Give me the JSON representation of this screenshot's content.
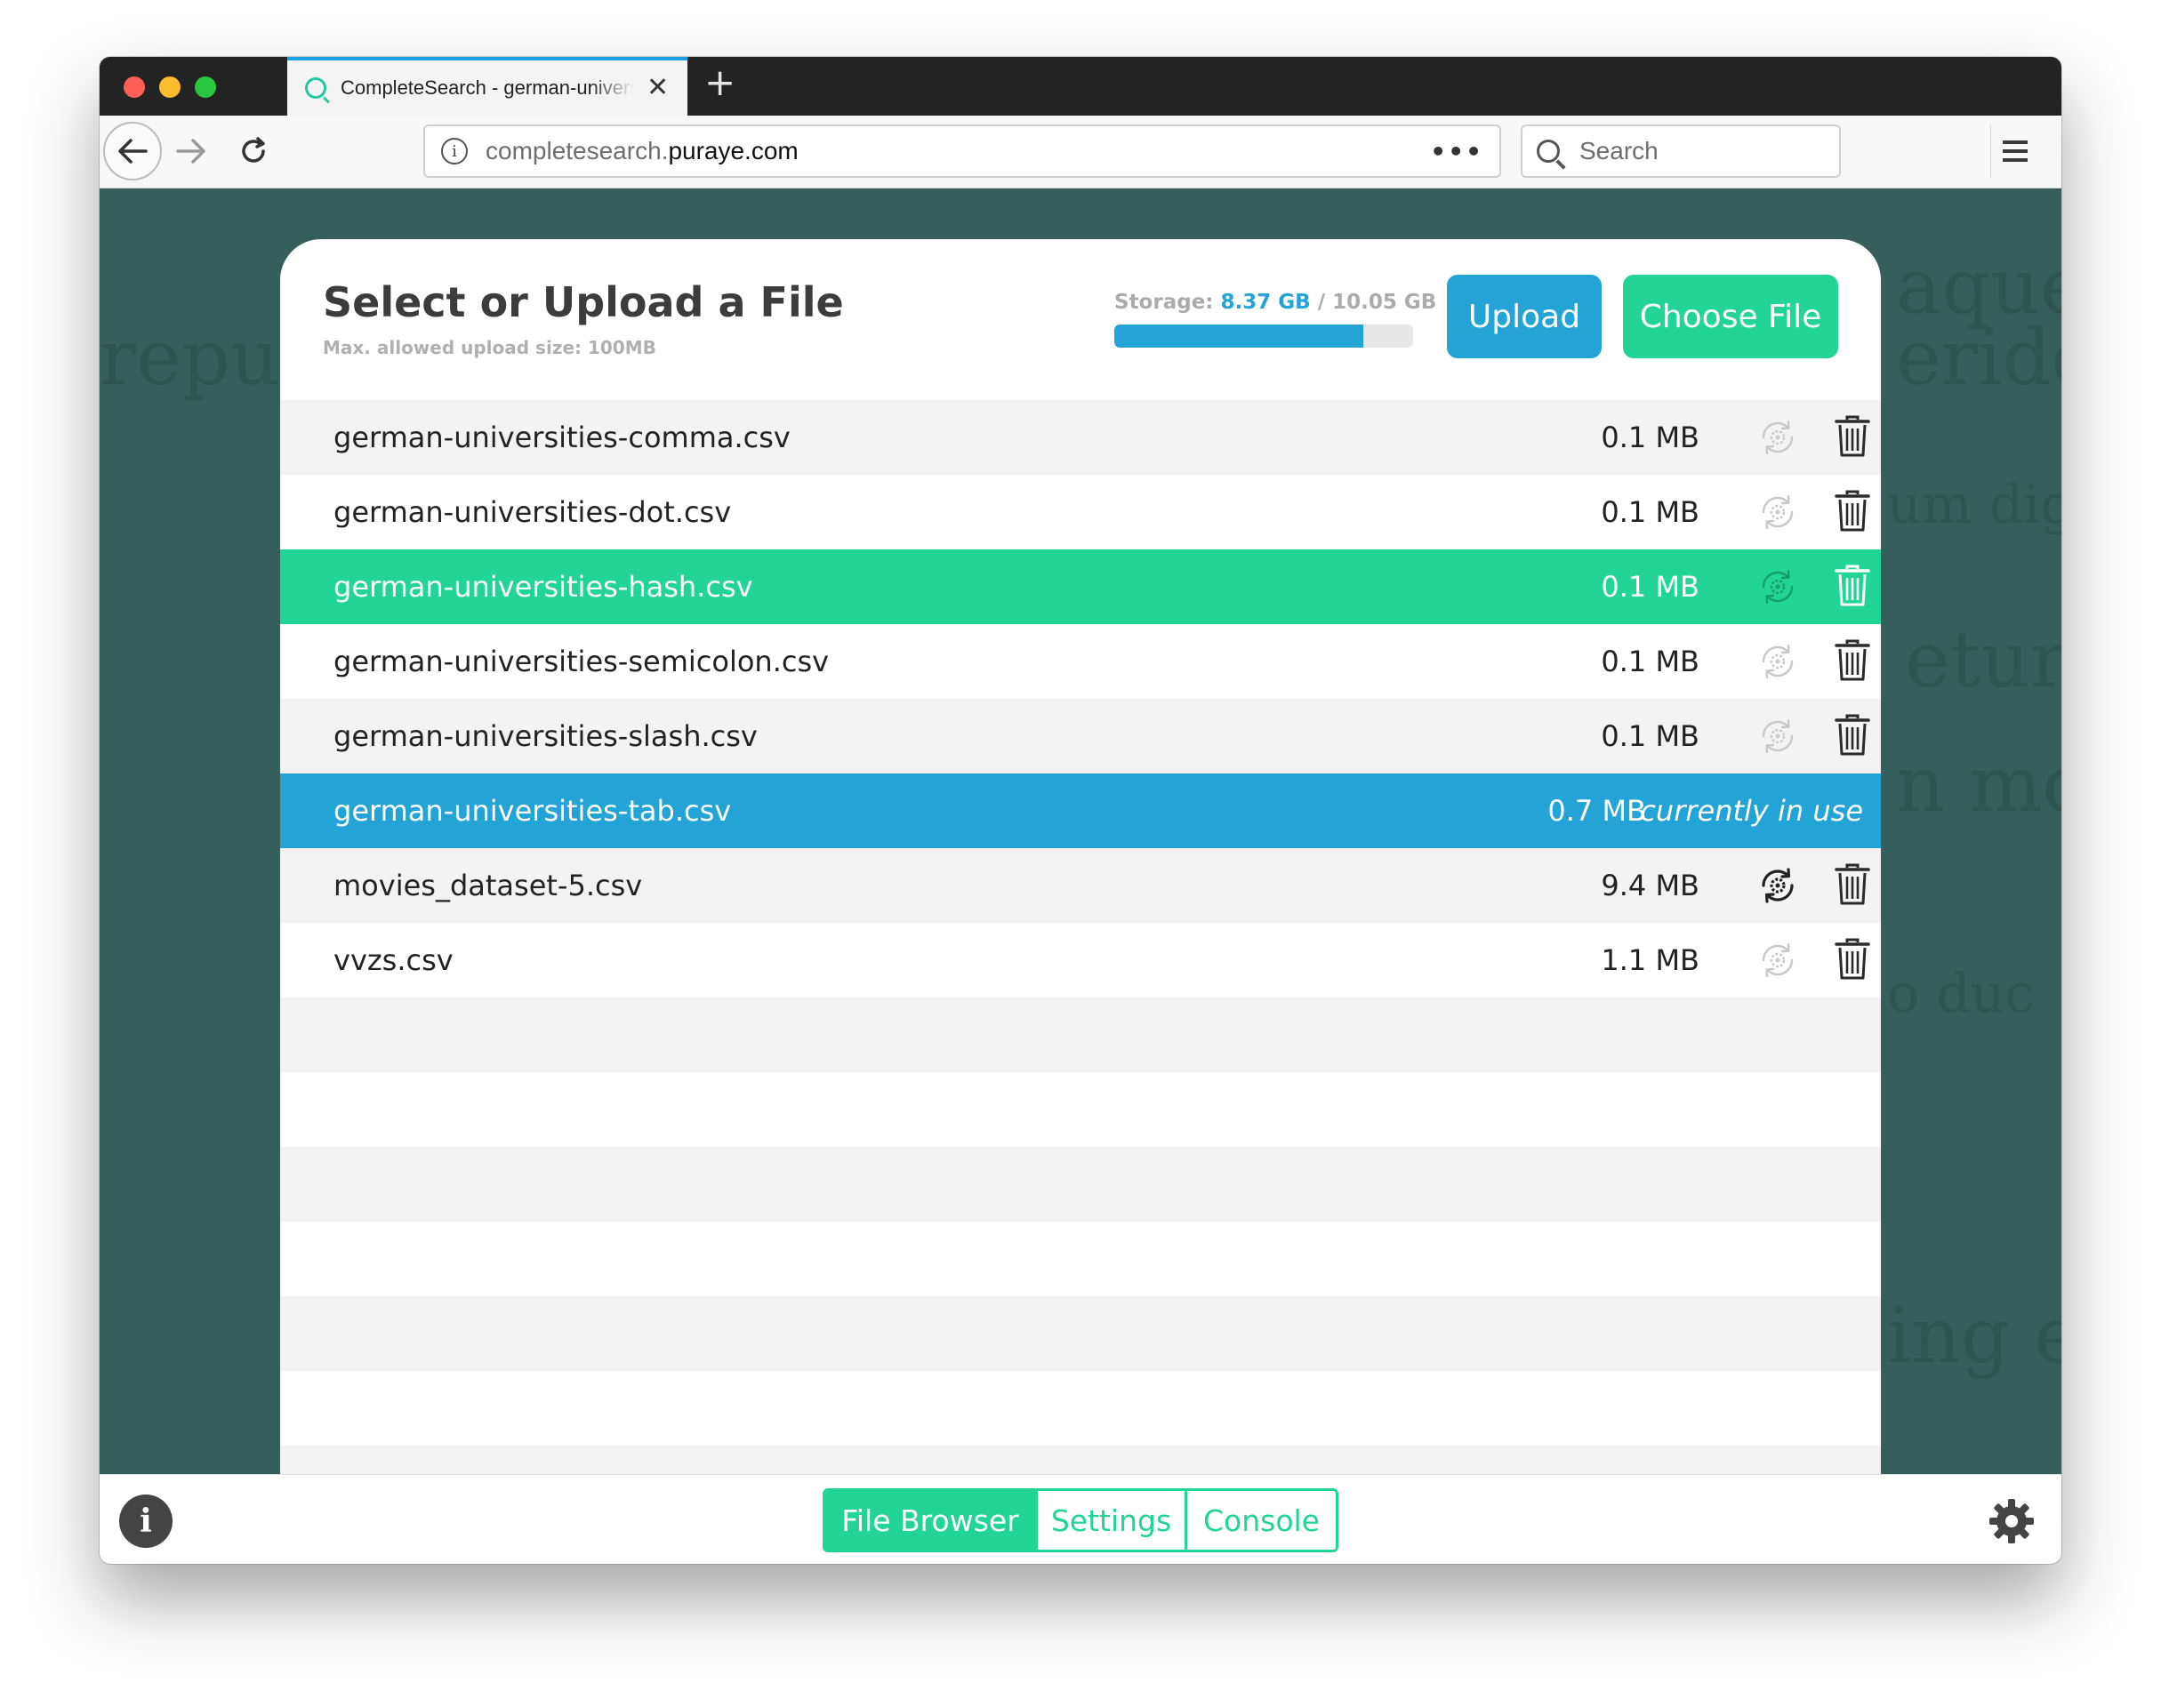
{
  "browser": {
    "tab_title": "CompleteSearch - german-universities-tab.csv",
    "tab_close": "✕",
    "new_tab": "+",
    "url_prefix": "completesearch.",
    "url_domain": "puraye.com",
    "url_more": "•••",
    "search_placeholder": "Search",
    "icons": {
      "back": "arrow-left-icon",
      "forward": "arrow-right-icon",
      "reload": "reload-icon",
      "info": "info-icon",
      "menu": "hamburger-menu-icon",
      "search": "search-icon"
    }
  },
  "dialog": {
    "title": "Select or Upload a File",
    "subtitle": "Max. allowed upload size: 100MB",
    "storage_label": "Storage:",
    "storage_used": "8.37 GB",
    "storage_total": "/ 10.05 GB",
    "storage_fraction": 0.833,
    "upload_label": "Upload",
    "choose_label": "Choose File"
  },
  "files": [
    {
      "name": "german-universities-comma.csv",
      "size": "0.1 MB",
      "state": "normal",
      "settings_icon": "gear-cycle-icon",
      "active_settings": false
    },
    {
      "name": "german-universities-dot.csv",
      "size": "0.1 MB",
      "state": "normal",
      "settings_icon": "gear-cycle-icon",
      "active_settings": false
    },
    {
      "name": "german-universities-hash.csv",
      "size": "0.1 MB",
      "state": "selected",
      "settings_icon": "gear-cycle-icon",
      "active_settings": false
    },
    {
      "name": "german-universities-semicolon.csv",
      "size": "0.1 MB",
      "state": "normal",
      "settings_icon": "gear-cycle-icon",
      "active_settings": false
    },
    {
      "name": "german-universities-slash.csv",
      "size": "0.1 MB",
      "state": "normal",
      "settings_icon": "gear-cycle-icon",
      "active_settings": false
    },
    {
      "name": "german-universities-tab.csv",
      "size": "0.7 MB",
      "state": "inuse",
      "inuse_label": "currently in use"
    },
    {
      "name": "movies_dataset-5.csv",
      "size": "9.4 MB",
      "state": "normal",
      "settings_icon": "gear-cycle-icon",
      "active_settings": true
    },
    {
      "name": "vvzs.csv",
      "size": "1.1 MB",
      "state": "normal",
      "settings_icon": "gear-cycle-icon",
      "active_settings": false
    }
  ],
  "empty_rows": 7,
  "bottom": {
    "tabs": [
      "File Browser",
      "Settings",
      "Console"
    ],
    "active_tab": "File Browser",
    "info_glyph": "i",
    "icons": {
      "info": "info-circle-icon",
      "settings": "gear-icon"
    }
  },
  "colors": {
    "green": "#22d597",
    "blue": "#23a3d6",
    "background": "#365e5a"
  }
}
